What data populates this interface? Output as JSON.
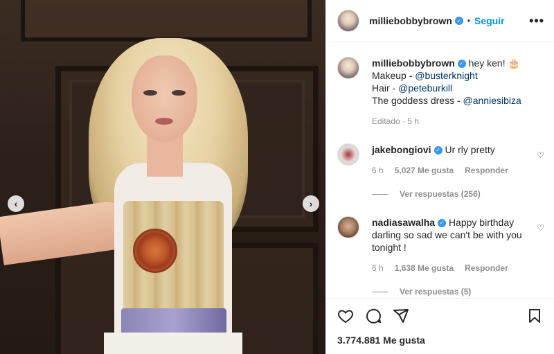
{
  "post": {
    "username": "milliebobbybrown",
    "follow_label": "Seguir",
    "more_label": "•••",
    "dot": "•",
    "caption": {
      "text": "hey ken! 🎂",
      "lines": [
        {
          "label": "Makeup - ",
          "mention": "@busterknight"
        },
        {
          "label": "Hair - ",
          "mention": "@peteburkill"
        },
        {
          "label": "The goddess dress - ",
          "mention": "@anniesibiza"
        }
      ],
      "edited": "Editado · 5 h"
    },
    "likes": "3.774.881 Me gusta"
  },
  "comments": [
    {
      "username": "jakebongiovi",
      "text": "Ur rly pretty",
      "time": "6 h",
      "likes": "5,027 Me gusta",
      "reply_label": "Responder",
      "view_replies": "Ver respuestas (256)"
    },
    {
      "username": "nadiasawalha",
      "text": "Happy birthday darling so sad we can't be with you tonight !",
      "time": "6 h",
      "likes": "1,638 Me gusta",
      "reply_label": "Responder",
      "view_replies": "Ver respuestas (5)"
    }
  ],
  "carousel": {
    "prev": "‹",
    "next": "›"
  },
  "icons": [
    "heart-icon",
    "comment-icon",
    "share-icon",
    "bookmark-icon",
    "verified-icon"
  ],
  "colors": {
    "accent": "#0095f6",
    "verified": "#3897f0",
    "text": "#262626",
    "muted": "#8e8e8e"
  }
}
